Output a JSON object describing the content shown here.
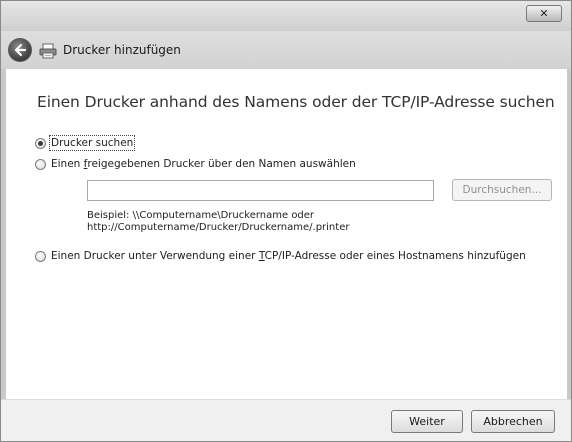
{
  "window": {
    "close_label": "✕",
    "title": "Drucker hinzufügen"
  },
  "main": {
    "heading": "Einen Drucker anhand des Namens oder der TCP/IP-Adresse suchen",
    "options": [
      {
        "label": "Drucker suchen",
        "checked": true
      },
      {
        "label_pre": "Einen ",
        "label_accel": "f",
        "label_post": "reigegebenen Drucker über den Namen auswählen",
        "checked": false
      },
      {
        "label_pre": "Einen Drucker unter Verwendung einer ",
        "label_accel": "T",
        "label_post": "CP/IP-Adresse oder eines Hostnamens hinzufügen",
        "checked": false
      }
    ],
    "name_input": {
      "value": "",
      "placeholder": ""
    },
    "browse_label": "Durchsuchen...",
    "example_line1": "Beispiel: \\\\Computername\\Druckername oder",
    "example_line2": "http://Computername/Drucker/Druckername/.printer"
  },
  "footer": {
    "next_label": "Weiter",
    "cancel_label": "Abbrechen"
  },
  "icons": {
    "back": "back-arrow-icon",
    "printer": "printer-icon"
  }
}
